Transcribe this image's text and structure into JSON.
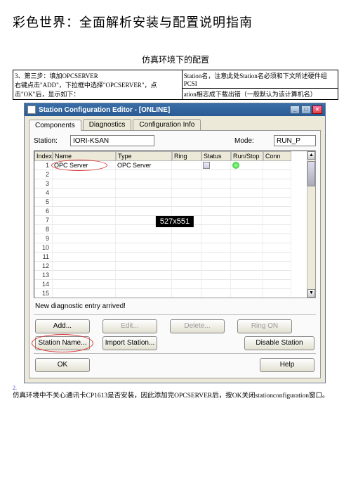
{
  "page_title": "彩色世界：全面解析安装与配置说明指南",
  "section_title": "仿真环境下的配置",
  "instruction": {
    "left_a": "3、第三步：填加OPCSERVER",
    "left_b": "右键点击\"ADD\"，下拉框中选择\"OPCSERVER\"，点击\"OK\"后，显示如下：",
    "right_a": "Station名，注意此处Station名必须和下文所述硬件组PCSI",
    "right_b": "ation相志成下载出错（一般默认为该计算机名）"
  },
  "window": {
    "title": "Station Configuration Editor - [ONLINE]",
    "tabs": [
      "Components",
      "Diagnostics",
      "Configuration Info"
    ],
    "station_label": "Station:",
    "station_value": "IORI-KSAN",
    "mode_label": "Mode:",
    "mode_value": "RUN_P",
    "columns": [
      "Index",
      "Name",
      "Type",
      "Ring",
      "Status",
      "Run/Stop",
      "Conn"
    ],
    "rows": [
      {
        "index": "1",
        "name": "OPC Server",
        "type": "OPC Server",
        "ring": "",
        "status_icon": true,
        "run_icon": true,
        "conn": ""
      }
    ],
    "empty_rows": [
      "2",
      "3",
      "4",
      "5",
      "6",
      "7",
      "8",
      "9",
      "10",
      "11",
      "12",
      "13",
      "14",
      "15"
    ],
    "overlay": "527x551",
    "diag_text": "New diagnostic entry arrived!",
    "buttons": {
      "add": "Add...",
      "edit": "Edit...",
      "delete": "Delete...",
      "ring_on": "Ring ON",
      "station_name": "Station Name...",
      "import_station": "Import Station...",
      "disable_station": "Disable Station",
      "ok": "OK",
      "help": "Help"
    }
  },
  "foot_num": "2.",
  "footnote": "仿真环境中不关心通讯卡CP1613是否安装，因此添加完OPCSERVER后，按OK关闭stationconfiguration窗口。"
}
